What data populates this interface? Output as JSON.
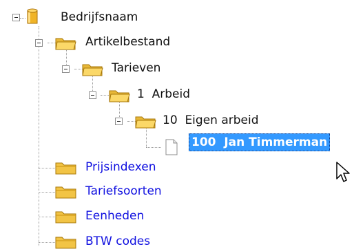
{
  "tree": {
    "root": {
      "label": "Bedrijfsnaam",
      "icon": "database-icon"
    },
    "artikelbestand": {
      "label": "Artikelbestand",
      "icon": "folder-open-icon"
    },
    "tarieven": {
      "label": "Tarieven",
      "icon": "folder-open-icon"
    },
    "arbeid": {
      "label": "1  Arbeid",
      "icon": "folder-open-icon"
    },
    "eigen_arbeid": {
      "label": "10  Eigen arbeid",
      "icon": "folder-open-icon"
    },
    "timmerman": {
      "label": "100  Jan Timmerman",
      "icon": "document-icon",
      "selected": true
    },
    "prijsindexen": {
      "label": "Prijsindexen",
      "icon": "folder-icon"
    },
    "tariefsoorten": {
      "label": "Tariefsoorten",
      "icon": "folder-icon"
    },
    "eenheden": {
      "label": "Eenheden",
      "icon": "folder-icon"
    },
    "btw_codes": {
      "label": "BTW codes",
      "icon": "folder-icon"
    }
  },
  "colors": {
    "selection": "#3399ff",
    "link_blue": "#1010e0",
    "folder": "#f4c44a"
  }
}
